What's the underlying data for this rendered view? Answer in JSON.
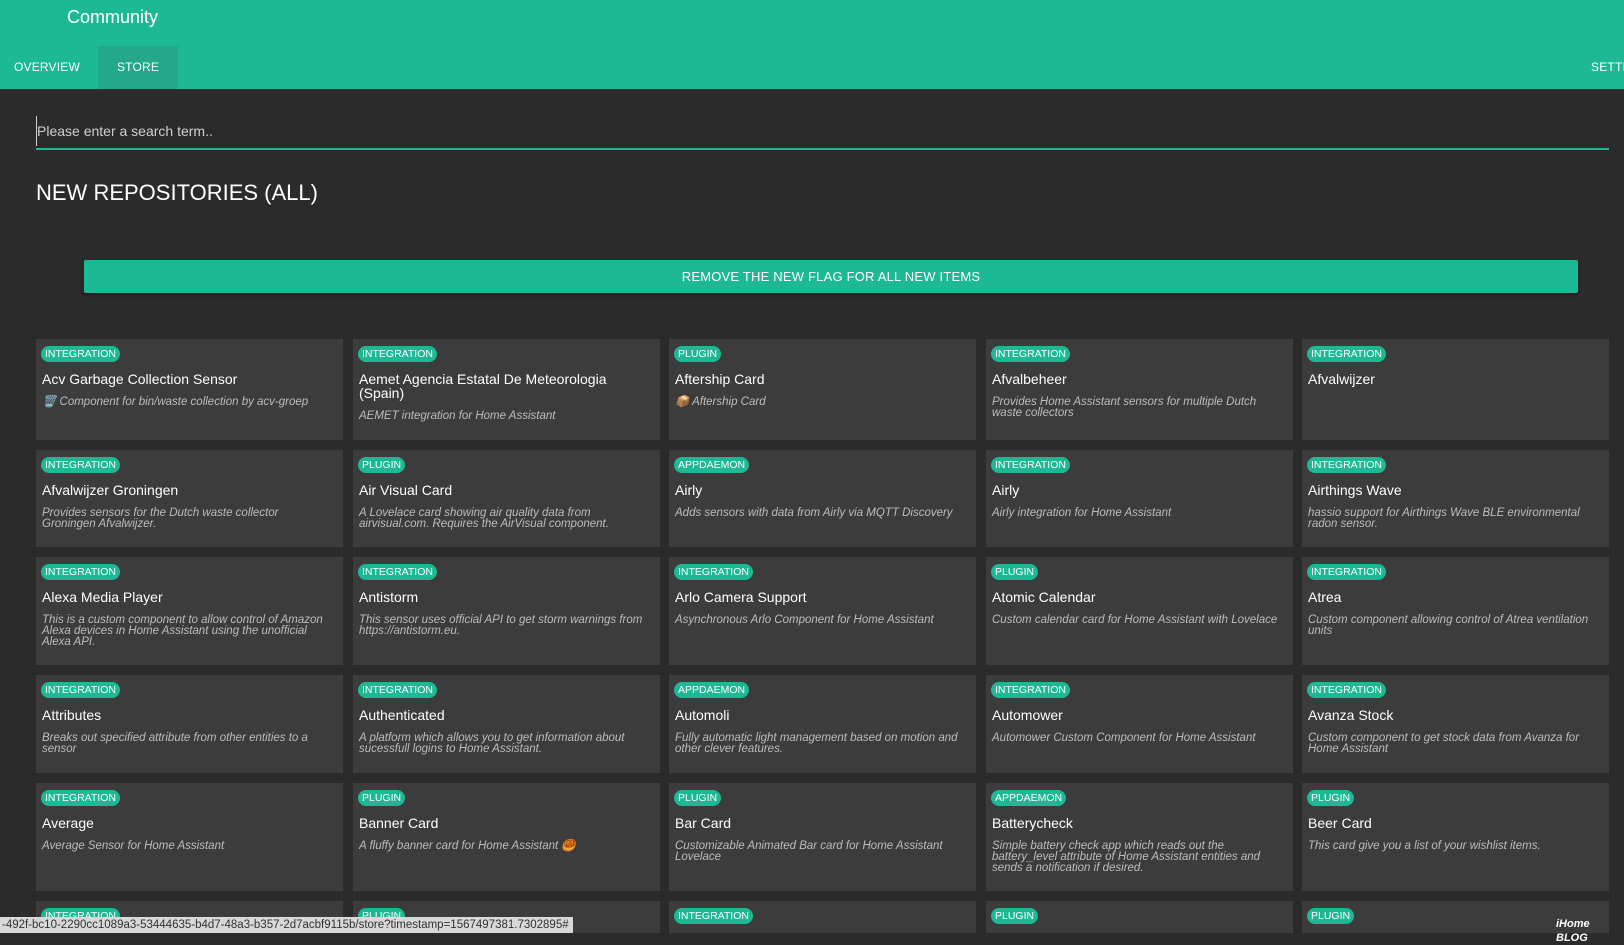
{
  "header": {
    "title": "Community",
    "tabs": [
      {
        "label": "OVERVIEW"
      },
      {
        "label": "STORE"
      },
      {
        "label": "SETTI"
      }
    ]
  },
  "colors": {
    "accent": "#1db994",
    "background": "#2b2b2b",
    "card": "#3c3c3c"
  },
  "search": {
    "placeholder": "Please enter a search term..",
    "value": ""
  },
  "section": {
    "title": "NEW REPOSITORIES (ALL)",
    "remove_flag_label": "REMOVE THE NEW FLAG FOR ALL NEW ITEMS"
  },
  "repositories": [
    {
      "category": "INTEGRATION",
      "name": "Acv Garbage Collection Sensor",
      "description": "🗑️ Component for bin/waste collection by acv-groep"
    },
    {
      "category": "INTEGRATION",
      "name": "Aemet Agencia Estatal De Meteorologia (Spain)",
      "description": "AEMET integration for Home Assistant"
    },
    {
      "category": "PLUGIN",
      "name": "Aftership Card",
      "description": "📦 Aftership Card"
    },
    {
      "category": "INTEGRATION",
      "name": "Afvalbeheer",
      "description": "Provides Home Assistant sensors for multiple Dutch waste collectors"
    },
    {
      "category": "INTEGRATION",
      "name": "Afvalwijzer",
      "description": ""
    },
    {
      "category": "INTEGRATION",
      "name": "Afvalwijzer Groningen",
      "description": "Provides sensors for the Dutch waste collector Groningen Afvalwijzer."
    },
    {
      "category": "PLUGIN",
      "name": "Air Visual Card",
      "description": "A Lovelace card showing air quality data from airvisual.com. Requires the AirVisual component."
    },
    {
      "category": "APPDAEMON",
      "name": "Airly",
      "description": "Adds sensors with data from Airly via MQTT Discovery"
    },
    {
      "category": "INTEGRATION",
      "name": "Airly",
      "description": "Airly integration for Home Assistant"
    },
    {
      "category": "INTEGRATION",
      "name": "Airthings Wave",
      "description": "hassio support for Airthings Wave BLE environmental radon sensor."
    },
    {
      "category": "INTEGRATION",
      "name": "Alexa Media Player",
      "description": "This is a custom component to allow control of Amazon Alexa devices in Home Assistant using the unofficial Alexa API."
    },
    {
      "category": "INTEGRATION",
      "name": "Antistorm",
      "description": "This sensor uses official API to get storm warnings from https://antistorm.eu."
    },
    {
      "category": "INTEGRATION",
      "name": "Arlo Camera Support",
      "description": "Asynchronous Arlo Component for Home Assistant"
    },
    {
      "category": "PLUGIN",
      "name": "Atomic Calendar",
      "description": "Custom calendar card for Home Assistant with Lovelace"
    },
    {
      "category": "INTEGRATION",
      "name": "Atrea",
      "description": "Custom component allowing control of Atrea ventilation units"
    },
    {
      "category": "INTEGRATION",
      "name": "Attributes",
      "description": "Breaks out specified attribute from other entities to a sensor"
    },
    {
      "category": "INTEGRATION",
      "name": "Authenticated",
      "description": "A platform which allows you to get information about sucessfull logins to Home Assistant."
    },
    {
      "category": "APPDAEMON",
      "name": "Automoli",
      "description": "Fully automatic light management based on motion and other clever features."
    },
    {
      "category": "INTEGRATION",
      "name": "Automower",
      "description": "Automower Custom Component for Home Assistant"
    },
    {
      "category": "INTEGRATION",
      "name": "Avanza Stock",
      "description": "Custom component to get stock data from Avanza for Home Assistant"
    },
    {
      "category": "INTEGRATION",
      "name": "Average",
      "description": "Average Sensor for Home Assistant"
    },
    {
      "category": "PLUGIN",
      "name": "Banner Card",
      "description": "A fluffy banner card for Home Assistant 🥮"
    },
    {
      "category": "PLUGIN",
      "name": "Bar Card",
      "description": "Customizable Animated Bar card for Home Assistant Lovelace"
    },
    {
      "category": "APPDAEMON",
      "name": "Batterycheck",
      "description": "Simple battery check app which reads out the battery_level attribute of Home Assistant entities and sends a notification if desired."
    },
    {
      "category": "PLUGIN",
      "name": "Beer Card",
      "description": "This card give you a list of your wishlist items."
    },
    {
      "category": "INTEGRATION",
      "name": "",
      "description": ""
    },
    {
      "category": "PLUGIN",
      "name": "",
      "description": ""
    },
    {
      "category": "INTEGRATION",
      "name": "",
      "description": ""
    },
    {
      "category": "PLUGIN",
      "name": "",
      "description": ""
    },
    {
      "category": "PLUGIN",
      "name": "",
      "description": ""
    }
  ],
  "status_bar": {
    "url": "-492f-bc10-2290cc1089a3-53444635-b4d7-48a3-b357-2d7acbf9115b/store?timestamp=1567497381.7302895#"
  },
  "watermark": {
    "text": "iHome BLOG"
  }
}
